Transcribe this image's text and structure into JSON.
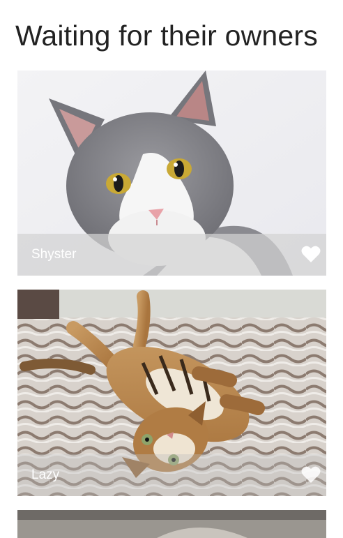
{
  "page": {
    "title": "Waiting for their owners"
  },
  "cards": [
    {
      "name": "Shyster",
      "icon": "heart-icon"
    },
    {
      "name": "Lazy",
      "icon": "heart-icon"
    },
    {
      "name": ""
    }
  ],
  "colors": {
    "title": "#222222",
    "caption_text": "#ffffff",
    "caption_bg": "rgba(210,210,210,0.72)"
  }
}
